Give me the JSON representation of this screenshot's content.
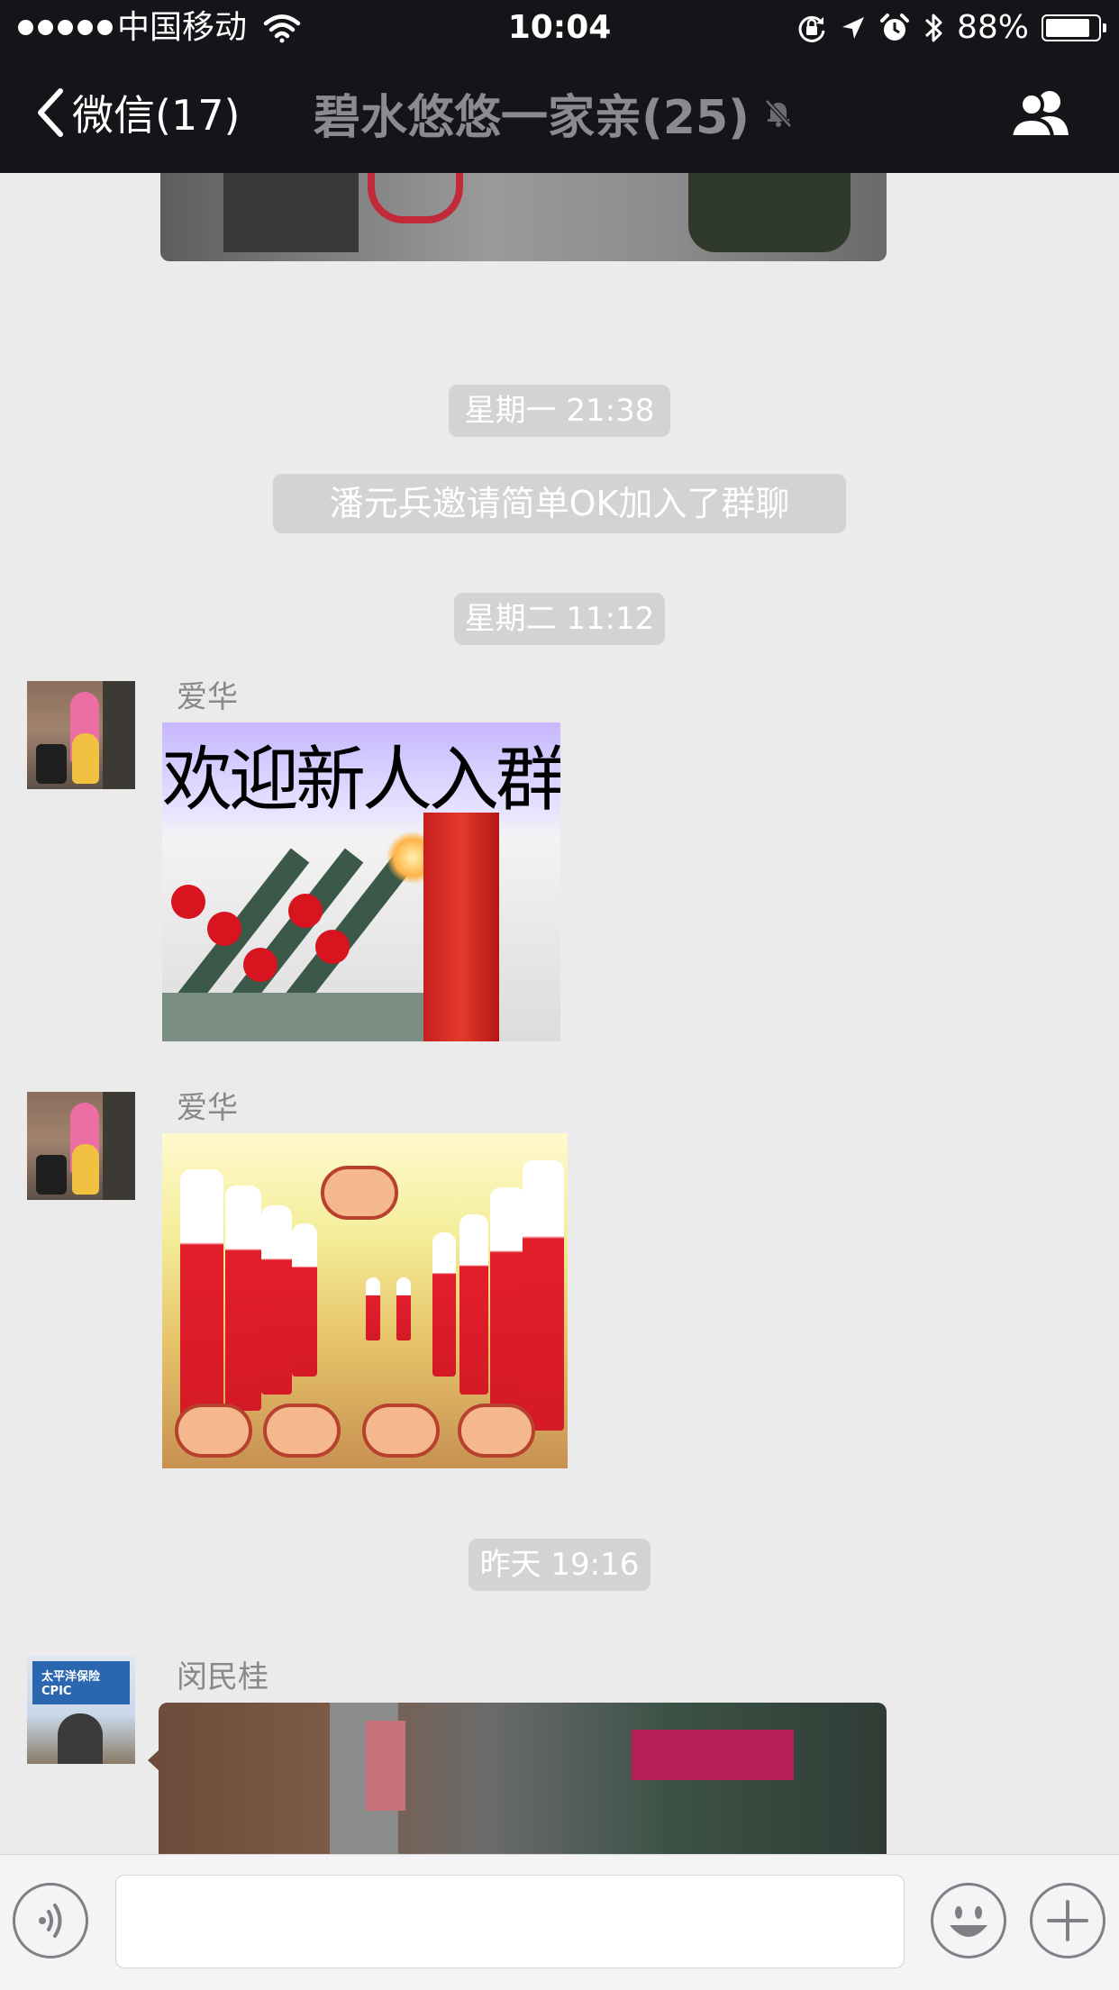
{
  "status_bar": {
    "carrier": "中国移动",
    "time": "10:04",
    "battery_percent": "88%",
    "battery_level": 0.88,
    "signal_bars": 5,
    "icons": [
      "wifi-icon",
      "rotation-lock-icon",
      "location-arrow-icon",
      "alarm-icon",
      "bluetooth-icon",
      "battery-icon"
    ]
  },
  "nav": {
    "back_label": "微信(17)",
    "title": "碧水悠悠一家亲(25)",
    "icons": [
      "chevron-left-icon",
      "mute-bell-icon",
      "group-members-icon"
    ]
  },
  "messages": {
    "timestamp_mon": "星期一 21:38",
    "system_join": "潘元兵邀请简单OK加入了群聊",
    "timestamp_tue": "星期二 11:12",
    "sender_1": "爱华",
    "welcome_caption": "欢迎新人入群！",
    "sender_2": "爱华",
    "timestamp_yesterday": "昨天 19:16",
    "sender_3": "闵民桂",
    "avatar_sign_text": "太平洋保险 CPIC"
  },
  "input_bar": {
    "placeholder": "",
    "icons": [
      "voice-icon",
      "emoji-icon",
      "plus-icon"
    ]
  },
  "colors": {
    "nav_background": "#141419",
    "title_gray": "#8a8a8f",
    "chat_background": "#ebebeb",
    "chip_background": "#d3d3d3",
    "sender_gray": "#888888"
  }
}
